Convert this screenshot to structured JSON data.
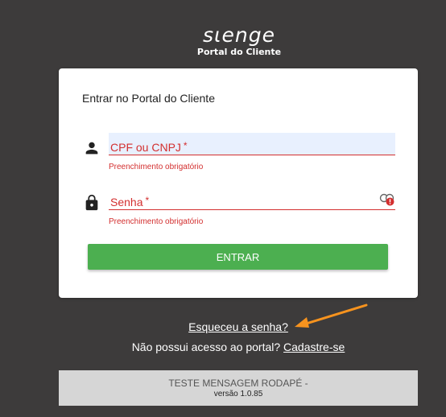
{
  "logo": {
    "brand": "sιenge",
    "subtitle": "Portal do Cliente"
  },
  "login": {
    "title": "Entrar no Portal do Cliente",
    "cpf_label": "CPF ou CNPJ",
    "cpf_error": "Preenchimento obrigatório",
    "password_label": "Senha",
    "password_error": "Preenchimento obrigatório",
    "required_mark": "*",
    "enter_label": "ENTRAR"
  },
  "links": {
    "forgot": "Esqueceu a senha?",
    "no_access": "Não possui acesso ao portal?",
    "signup": "Cadastre-se"
  },
  "footer": {
    "message": "TESTE MENSAGEM RODAPÉ -",
    "version": "versão 1.0.85"
  },
  "colors": {
    "background": "#3d3b3b",
    "error": "#d32f2f",
    "button": "#4caf50",
    "arrow": "#f7931e"
  },
  "icons": [
    "person-icon",
    "lock-icon",
    "password-visibility-icon",
    "arrow-icon"
  ]
}
